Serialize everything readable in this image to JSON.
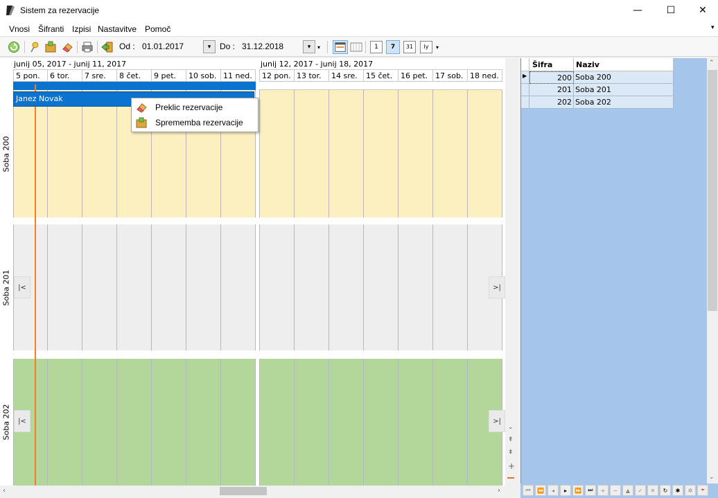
{
  "window": {
    "title": "Sistem za rezervacije",
    "minimize": "—",
    "maximize": "☐",
    "close": "✕"
  },
  "menu": {
    "items": [
      "Vnosi",
      "Šifranti",
      "Izpisi",
      "Nastavitve",
      "Pomoč"
    ]
  },
  "toolbar": {
    "od_label": "Od :",
    "od_value": "01.01.2017",
    "do_label": "Do :",
    "do_value": "31.12.2018",
    "dropdown_glyph": "▾",
    "day_view": "1",
    "week_view": "7",
    "month_view": "31",
    "year_view": "ly"
  },
  "scheduler": {
    "week1_title": "junij 05, 2017 - junij 11, 2017",
    "week2_title": "junij 12, 2017 - junij 18, 2017",
    "days_week1": [
      "5 pon.",
      "6 tor.",
      "7 sre.",
      "8 čet.",
      "9 pet.",
      "10 sob.",
      "11 ned."
    ],
    "days_week2": [
      "12 pon.",
      "13 tor.",
      "14 sre.",
      "15 čet.",
      "16 pet.",
      "17 sob.",
      "18 ned."
    ],
    "resources": [
      "Soba 200",
      "Soba 201",
      "Soba 202"
    ],
    "appointment": "Janez Novak",
    "nav_prev": "|<",
    "nav_next": ">|",
    "colors": {
      "soba200": "#fcf0c0",
      "soba201": "#eeeeee",
      "soba202": "#b3d69b",
      "appointment": "#0a73d0",
      "current_time": "#f08030"
    }
  },
  "context_menu": {
    "items": [
      "Preklic rezervacije",
      "Sprememba rezervacije"
    ]
  },
  "grid": {
    "headers": [
      "Šifra",
      "Naziv"
    ],
    "rows": [
      {
        "sifra": "200",
        "naziv": "Soba 200"
      },
      {
        "sifra": "201",
        "naziv": "Soba 201"
      },
      {
        "sifra": "202",
        "naziv": "Soba 202"
      }
    ],
    "selected_row": 0,
    "background": "#a6c5ea"
  }
}
